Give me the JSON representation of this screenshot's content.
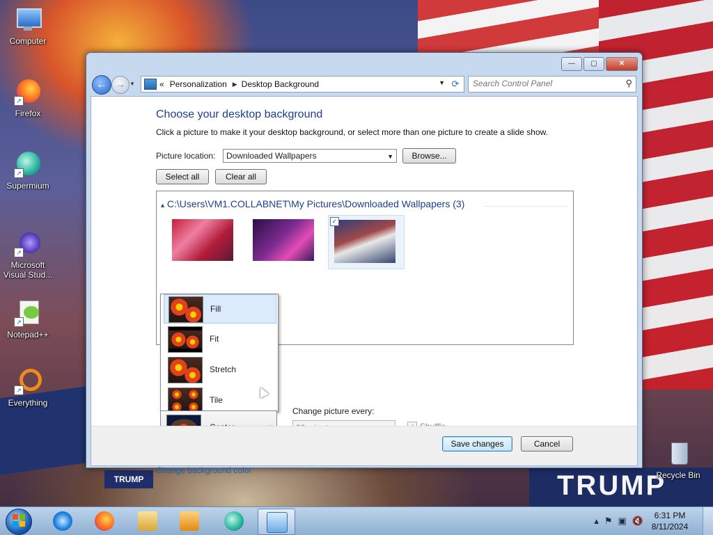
{
  "desktop": {
    "icons": [
      {
        "label": "Computer"
      },
      {
        "label": "Firefox"
      },
      {
        "label": "Supermium"
      },
      {
        "label": "Microsoft Visual Stud..."
      },
      {
        "label": "Notepad++"
      },
      {
        "label": "Everything"
      },
      {
        "label": "Recycle Bin"
      }
    ],
    "wallpaper_text": {
      "banner": "TRUMP",
      "small_banner": "TRUMP"
    }
  },
  "window": {
    "controls": {
      "minimize": "—",
      "maximize": "▢",
      "close": "✕"
    },
    "address": {
      "prefix": "«",
      "crumbs": [
        "Personalization",
        "Desktop Background"
      ],
      "separator": "▶"
    },
    "search": {
      "placeholder": "Search Control Panel"
    },
    "heading": "Choose your desktop background",
    "subheading": "Click a picture to make it your desktop background, or select more than one picture to create a slide show.",
    "picture_location": {
      "label": "Picture location:",
      "value": "Downloaded Wallpapers",
      "browse": "Browse..."
    },
    "buttons": {
      "select_all": "Select all",
      "clear_all": "Clear all"
    },
    "gallery": {
      "folder": "C:\\Users\\VM1.COLLABNET\\My Pictures\\Downloaded Wallpapers (3)",
      "thumbnails": [
        {
          "checked": false
        },
        {
          "checked": false
        },
        {
          "checked": true
        }
      ]
    },
    "picture_position": {
      "options": [
        "Fill",
        "Fit",
        "Stretch",
        "Tile"
      ],
      "selected": "Center"
    },
    "change_every": {
      "label": "Change picture every:",
      "value": "30 minutes",
      "shuffle": "Shuffle"
    },
    "bg_color_link": "Change background color",
    "footer": {
      "save": "Save changes",
      "cancel": "Cancel"
    }
  },
  "taskbar": {
    "apps": [
      "Internet Explorer",
      "Firefox",
      "Windows Explorer",
      "Windows Media Player",
      "Supermium",
      "Control Panel"
    ],
    "clock": {
      "time": "6:31 PM",
      "date": "8/11/2024"
    }
  },
  "colors": {
    "heading": "#1e3f8c",
    "link": "#1c62b4",
    "taskbar": "#a8c2df"
  }
}
